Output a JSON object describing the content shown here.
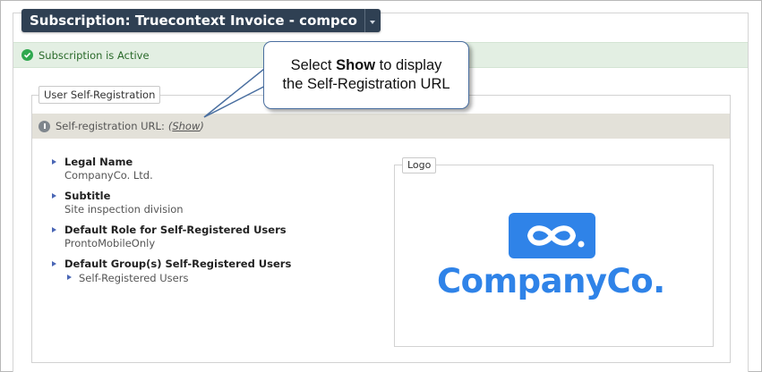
{
  "header": {
    "title": "Subscription: Truecontext Invoice - compco"
  },
  "status": {
    "text": "Subscription is Active",
    "color": "#2fa84f"
  },
  "self_registration": {
    "legend": "User Self-Registration",
    "url_label": "Self-registration URL:",
    "url_paren_open": "(",
    "url_link": "Show",
    "url_paren_close": ")"
  },
  "properties": [
    {
      "label": "Legal Name",
      "value": "CompanyCo. Ltd."
    },
    {
      "label": "Subtitle",
      "value": "Site inspection division"
    },
    {
      "label": "Default Role for Self-Registered Users",
      "value": "ProntoMobileOnly"
    },
    {
      "label": "Default Group(s) Self-Registered Users",
      "sub_items": [
        "Self-Registered Users"
      ]
    }
  ],
  "logo": {
    "legend": "Logo",
    "wordmark": "CompanyCo.",
    "brand_color": "#2f83e8"
  },
  "callout": {
    "line1_pre": "Select ",
    "line1_bold": "Show",
    "line1_post": " to display",
    "line2": "the Self-Registration URL"
  },
  "icons": {
    "status": "check-circle-icon",
    "info": "info-icon",
    "dropdown": "caret-down-icon",
    "bullet": "triangle-right-icon",
    "logo": "infinity-loop-icon"
  }
}
